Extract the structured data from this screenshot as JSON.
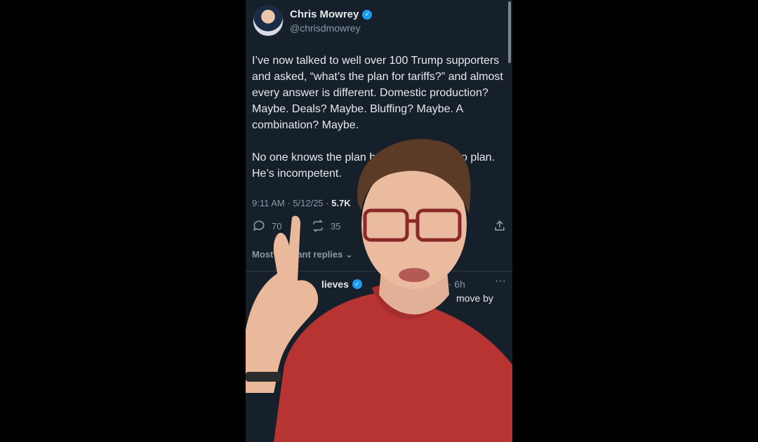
{
  "tweet": {
    "display_name": "Chris Mowrey",
    "handle": "@chrisdmowrey",
    "text": "I’ve now talked to well over 100 Trump supporters and asked, “what’s the plan for tariffs?” and almost every answer is different. Domestic production? Maybe. Deals? Maybe. Bluffing? Maybe. A combination? Maybe.\n\nNo one knows the plan because there is no plan. He’s incompetent.",
    "time": "9:11 AM · 5/12/25 · ",
    "views": "5.7K",
    "replies_count": "70",
    "retweets_count": "35"
  },
  "replies": {
    "sort_label": "Most relevant replies",
    "first_reply_name": "lieves",
    "first_reply_time": "es · 6h",
    "first_reply_text": "move by"
  },
  "colors": {
    "background": "#16202b",
    "accent": "#1d9bf0",
    "shirt": "#b83433"
  },
  "icons": [
    "verified-icon",
    "reply-icon",
    "retweet-icon",
    "share-icon",
    "more-icon",
    "chevron-down-icon"
  ]
}
